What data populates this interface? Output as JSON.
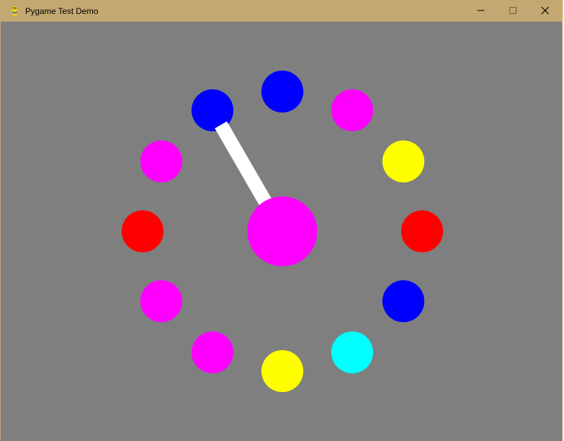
{
  "window": {
    "title": "Pygame Test Demo",
    "app_icon": "pygame-snake-icon",
    "controls": {
      "minimize": "minimize-icon",
      "maximize": "maximize-icon",
      "close": "close-icon"
    }
  },
  "scene": {
    "background": "#7f7f7f",
    "center_disc_color": "#ff00ff",
    "hand_color": "#ffffff",
    "ring_circles": [
      {
        "name": "twelve-oclock",
        "color": "#0000ff"
      },
      {
        "name": "one-oclock",
        "color": "#ff00ff"
      },
      {
        "name": "two-oclock",
        "color": "#ffff00"
      },
      {
        "name": "three-oclock",
        "color": "#ff0000"
      },
      {
        "name": "four-oclock",
        "color": "#0000ff"
      },
      {
        "name": "five-oclock",
        "color": "#00ffff"
      },
      {
        "name": "six-oclock",
        "color": "#ffff00"
      },
      {
        "name": "seven-oclock",
        "color": "#ff00ff"
      },
      {
        "name": "eight-oclock",
        "color": "#ff00ff"
      },
      {
        "name": "nine-oclock",
        "color": "#ff0000"
      },
      {
        "name": "ten-oclock",
        "color": "#ff00ff"
      },
      {
        "name": "eleven-oclock",
        "color": "#0000ff"
      }
    ],
    "hand_points_to": "eleven-oclock"
  }
}
